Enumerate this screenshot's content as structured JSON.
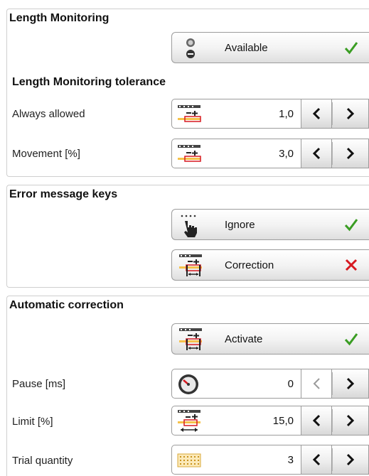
{
  "length_monitoring": {
    "title": "Length Monitoring",
    "available_button": {
      "label": "Available",
      "icon": "toggle-switch-icon",
      "status": "checked"
    },
    "tolerance": {
      "title": "Length Monitoring tolerance",
      "rows": [
        {
          "label": "Always allowed",
          "value": "1,0",
          "icon": "ruler-tolerance-icon"
        },
        {
          "label": "Movement [%]",
          "value": "3,0",
          "icon": "ruler-tolerance-icon"
        }
      ]
    }
  },
  "error_keys": {
    "title": "Error message keys",
    "ignore_button": {
      "label": "Ignore",
      "icon": "hand-pointer-icon",
      "status": "checked"
    },
    "correction_button": {
      "label": "Correction",
      "icon": "ruler-correction-icon",
      "status": "unchecked"
    }
  },
  "automatic_correction": {
    "title": "Automatic correction",
    "activate_button": {
      "label": "Activate",
      "icon": "ruler-correction-icon",
      "status": "checked"
    },
    "rows": [
      {
        "label": "Pause [ms]",
        "value": "0",
        "icon": "stopwatch-icon",
        "prev_enabled": false
      },
      {
        "label": "Limit [%]",
        "value": "15,0",
        "icon": "ruler-limit-icon",
        "prev_enabled": true
      },
      {
        "label": "Trial quantity",
        "value": "3",
        "icon": "grid-quantity-icon",
        "prev_enabled": true
      }
    ]
  },
  "colors": {
    "check": "#3a9d23",
    "cross": "#d71920",
    "border": "#9c9c9c"
  }
}
